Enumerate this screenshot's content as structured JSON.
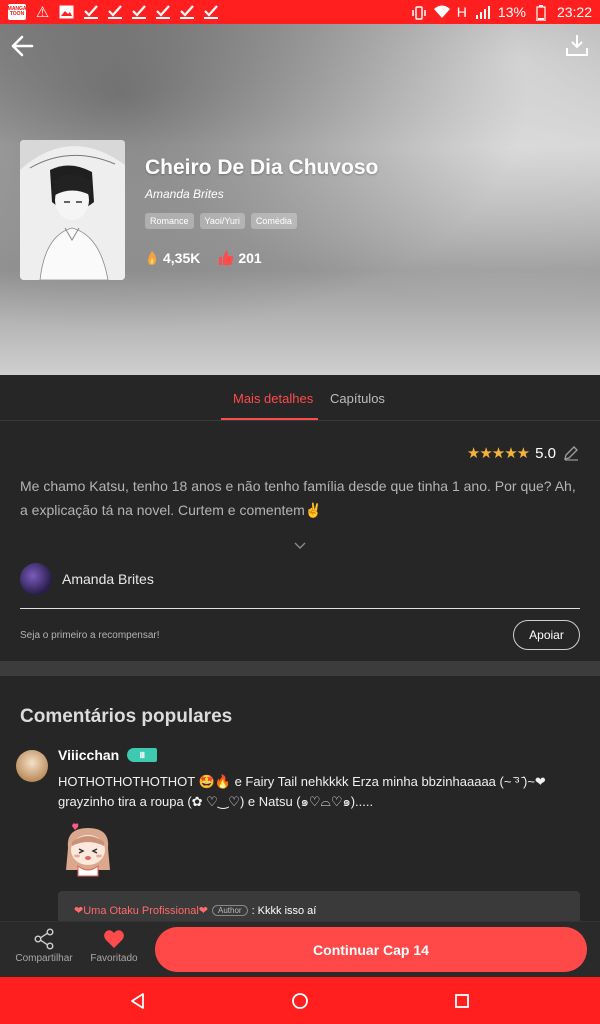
{
  "status_bar": {
    "app_badge": "MANGA TOON",
    "battery": "13%",
    "time": "23:22",
    "network": "H",
    "color": "#ff1f1f"
  },
  "book": {
    "title": "Cheiro De Dia Chuvoso",
    "author": "Amanda Brites",
    "tags": [
      "Romance",
      "Yaoi/Yuri",
      "Comédia"
    ],
    "views": "4,35K",
    "likes": "201"
  },
  "tabs": {
    "details": "Mais detalhes",
    "chapters": "Capítulos",
    "active": "details",
    "accent": "#ff4b4b"
  },
  "details": {
    "rating": "5.0",
    "stars": 5,
    "synopsis": "Me chamo Katsu, tenho 18 anos e não tenho família desde que tinha 1 ano. Por que? Ah, a explicação tá na novel. Curtem e comentem✌",
    "author_name": "Amanda Brites",
    "reward_text": "Seja o primeiro a recompensar!",
    "support_label": "Apoiar"
  },
  "comments": {
    "title": "Comentários populares",
    "items": [
      {
        "user": "Viiicchan",
        "text": "HOTHOTHOTHOTHOT 🤩🔥 e Fairy Tail nehkkkk Erza minha bbzinhaaaaa   (~ ̄³ ̄)~❤ grayzinho tira a roupa (✿ ♡‿♡) e Natsu (๑♡⌓♡๑).....",
        "reply": {
          "name": "❤Uma Otaku Profissional❤",
          "tag": "Author",
          "text": ": Kkkk isso aí"
        }
      }
    ]
  },
  "bottom_bar": {
    "share_label": "Compartilhar",
    "favorite_label": "Favoritado",
    "cta_label": "Continuar Cap 14"
  }
}
